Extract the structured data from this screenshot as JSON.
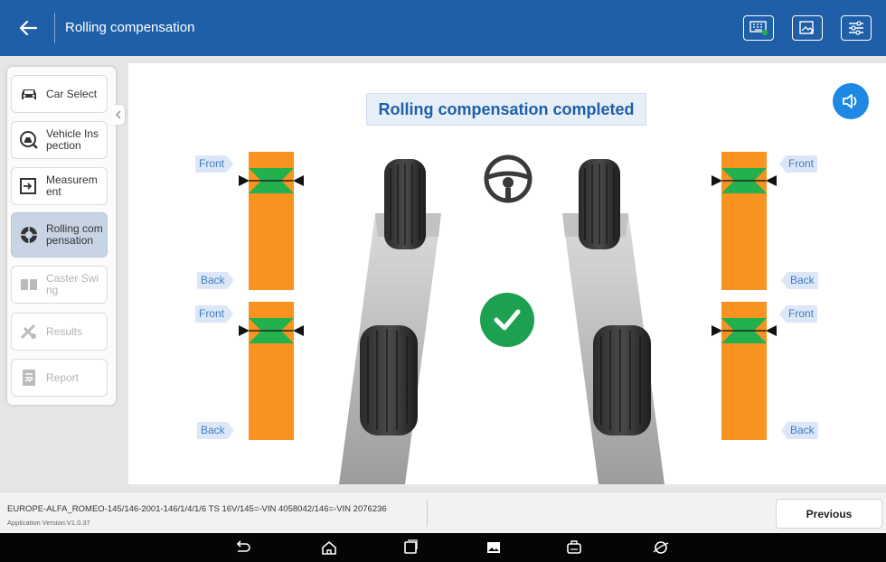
{
  "header": {
    "title": "Rolling compensation",
    "back_icon": "back-arrow-icon",
    "actions": [
      "keyboard-vci-icon",
      "screenshot-icon",
      "settings-sliders-icon"
    ]
  },
  "nav": {
    "items": [
      {
        "label": "Car Select",
        "icon": "car-icon",
        "state": "normal"
      },
      {
        "label": "Vehicle Inspection",
        "icon": "inspection-icon",
        "state": "normal"
      },
      {
        "label": "Measurement",
        "icon": "measurement-icon",
        "state": "normal"
      },
      {
        "label": "Rolling compensation",
        "icon": "rolling-icon",
        "state": "active"
      },
      {
        "label": "Caster Swing",
        "icon": "caster-icon",
        "state": "disabled"
      },
      {
        "label": "Results",
        "icon": "results-icon",
        "state": "disabled"
      },
      {
        "label": "Report",
        "icon": "report-icon",
        "state": "disabled"
      }
    ]
  },
  "main": {
    "status_message": "Rolling compensation completed",
    "labels": {
      "front": "Front",
      "back": "Back"
    },
    "status_icon": "check-circle-icon",
    "center_icon": "steering-wheel-icon",
    "sound_icon": "speaker-icon"
  },
  "footer": {
    "vehicle_path": "EUROPE-ALFA_ROMEO-145/146-2001-146/1/4/1/6 TS 16V/145=-VIN 4058042/146=-VIN 2076236",
    "app_version": "Application Version:V1.0.37",
    "previous_label": "Previous"
  },
  "system_bar": {
    "buttons": [
      "back-nav-icon",
      "home-icon",
      "recent-apps-icon",
      "gallery-icon",
      "vci-icon",
      "browser-icon"
    ]
  },
  "colors": {
    "header": "#1f5fa8",
    "gauge_orange": "#f7931e",
    "gauge_green": "#22b14c",
    "success": "#1da150",
    "accent": "#1e88e5"
  }
}
